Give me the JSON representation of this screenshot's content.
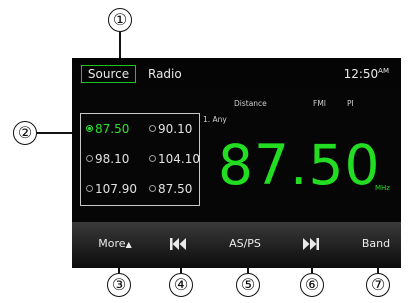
{
  "callouts": [
    "①",
    "②",
    "③",
    "④",
    "⑤",
    "⑥",
    "⑦"
  ],
  "header": {
    "source_label": "Source",
    "title": "Radio",
    "time": "12:50",
    "ampm": "AM"
  },
  "info": {
    "distance": "Distance",
    "fm": "FMI",
    "pi": "PI",
    "pty": "1. Any"
  },
  "presets": [
    {
      "freq": "87.50",
      "active": true
    },
    {
      "freq": "90.10",
      "active": false
    },
    {
      "freq": "98.10",
      "active": false
    },
    {
      "freq": "104.10",
      "active": false
    },
    {
      "freq": "107.90",
      "active": false
    },
    {
      "freq": "87.50",
      "active": false
    }
  ],
  "tuner": {
    "frequency": "87.50",
    "unit": "MHz"
  },
  "bottom": {
    "more": "More",
    "more_arrow": "▲",
    "asps": "AS/PS",
    "band": "Band"
  },
  "icons": {
    "prev": "skip-previous-icon",
    "next": "skip-next-icon"
  },
  "colors": {
    "accent": "#22dd22",
    "background": "#060606"
  }
}
